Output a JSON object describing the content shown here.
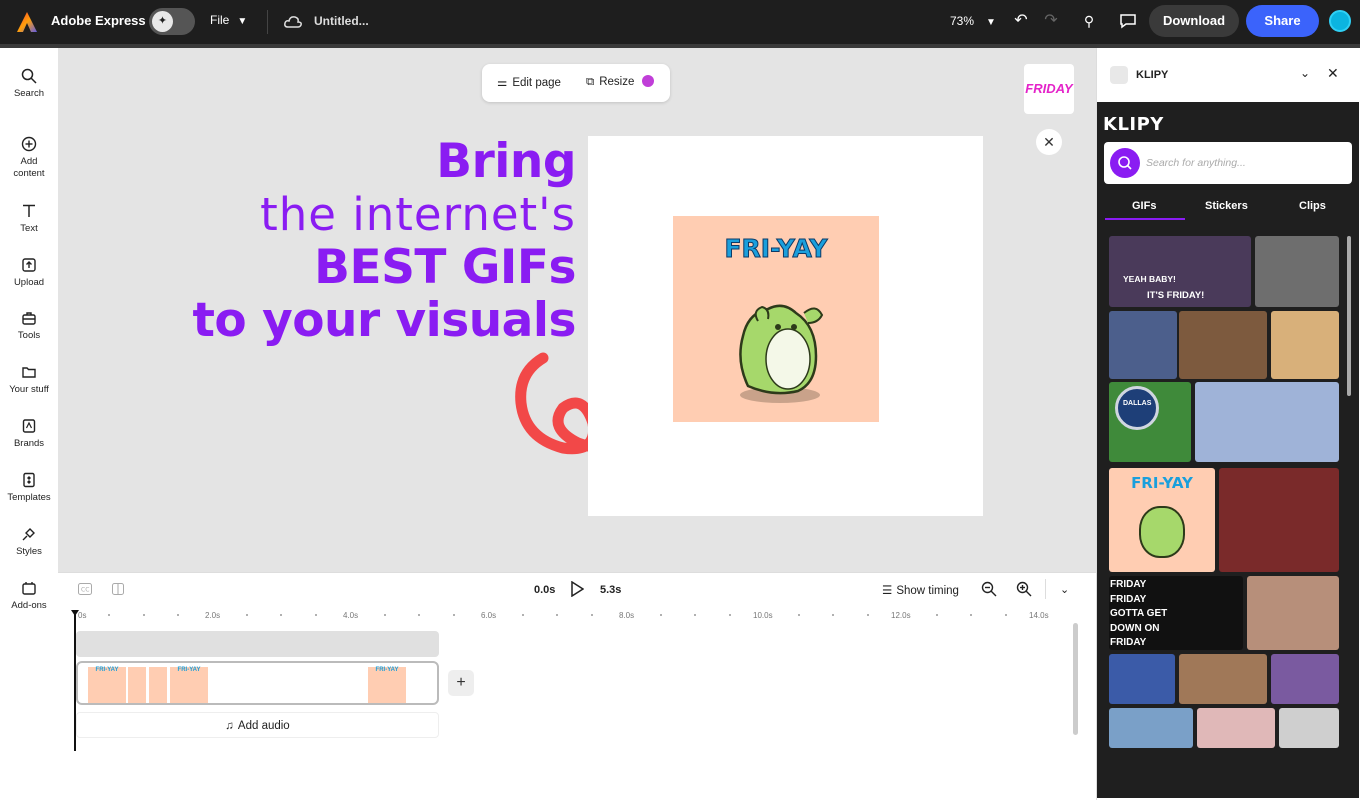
{
  "topbar": {
    "app_title": "Adobe Express",
    "file_label": "File",
    "doc_title": "Untitled...",
    "zoom": "73%",
    "download_label": "Download",
    "share_label": "Share"
  },
  "rail": [
    {
      "label": "Search",
      "icon": "search-icon"
    },
    {
      "label": "Add content",
      "icon": "plus-circle-icon"
    },
    {
      "label": "Text",
      "icon": "text-icon"
    },
    {
      "label": "Upload",
      "icon": "upload-icon"
    },
    {
      "label": "Tools",
      "icon": "toolbox-icon"
    },
    {
      "label": "Your stuff",
      "icon": "folder-icon"
    },
    {
      "label": "Brands",
      "icon": "brand-icon"
    },
    {
      "label": "Templates",
      "icon": "templates-icon"
    },
    {
      "label": "Styles",
      "icon": "styles-icon"
    },
    {
      "label": "Add-ons",
      "icon": "addons-icon"
    }
  ],
  "canvas": {
    "edit_page": "Edit page",
    "resize": "Resize",
    "headline": {
      "line1": "Bring",
      "line2": "the internet's",
      "line3": "BEST GIFs",
      "line4": "to your visuals"
    },
    "gif_text": "FRI-YAY",
    "thumb_text": "FRIDAY",
    "accent_color": "#8a1cf2",
    "arrow_color": "#f24848"
  },
  "timeline": {
    "start_time": "0.0s",
    "end_time": "5.3s",
    "show_timing": "Show timing",
    "ruler": [
      "0s",
      "2.0s",
      "4.0s",
      "6.0s",
      "8.0s",
      "10.0s",
      "12.0s",
      "14.0s"
    ],
    "add_audio": "Add audio",
    "clip_label": "FRI-YAY"
  },
  "panel": {
    "title": "KLIPY",
    "brand": "KLIPY",
    "search_placeholder": "Search for anything...",
    "tabs": [
      "GIFs",
      "Stickers",
      "Clips"
    ],
    "active_tab": "GIFs",
    "gif_captions": {
      "yeah_baby": "YEAH BABY!",
      "its_friday": "IT'S FRIDAY!",
      "friyay": "FRI-YAY",
      "friday_song_1": "FRIDAY",
      "friday_song_2": "FRIDAY",
      "friday_song_3": "GOTTA GET",
      "friday_song_4": "DOWN ON",
      "friday_song_5": "FRIDAY",
      "dallas": "DALLAS"
    }
  }
}
